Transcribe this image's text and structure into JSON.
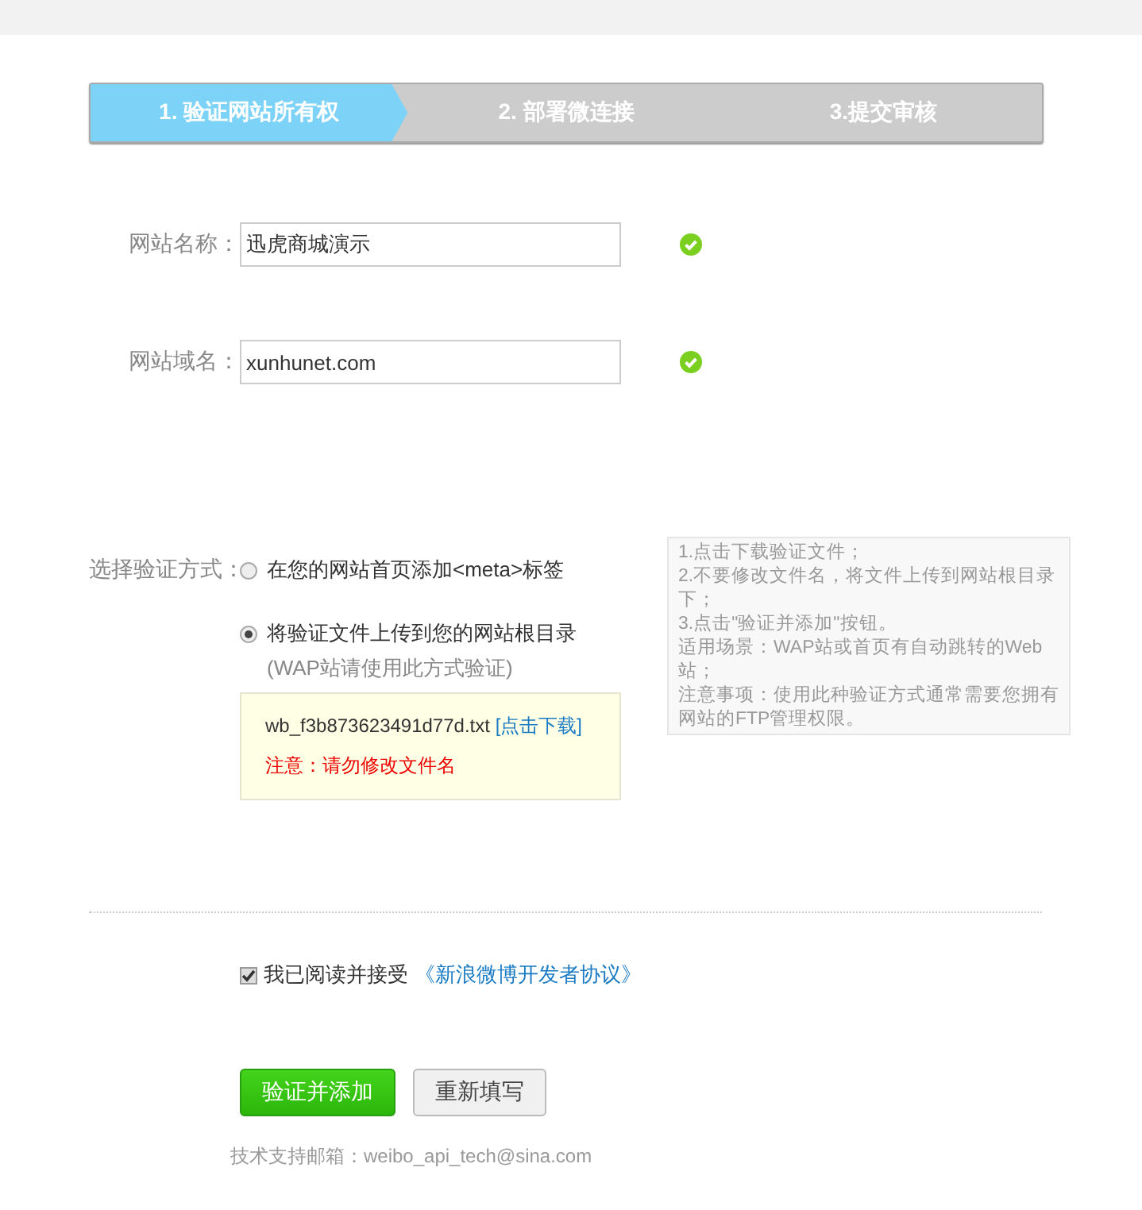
{
  "steps": [
    {
      "label": "1. 验证网站所有权",
      "selected": true
    },
    {
      "label": "2. 部署微连接",
      "selected": false
    },
    {
      "label": "3.提交审核",
      "selected": false
    }
  ],
  "fields": [
    {
      "label": "网站名称：",
      "value": "迅虎商城演示",
      "valid": true
    },
    {
      "label": "网站域名：",
      "value": "xunhunet.com",
      "valid": true
    }
  ],
  "verification": {
    "label": "选择验证方式：",
    "options": [
      {
        "label": "在您的网站首页添加<meta>标签",
        "selected": false
      },
      {
        "label": "将验证文件上传到您的网站根目录",
        "note": "(WAP站请使用此方式验证)",
        "selected": true
      }
    ],
    "file": {
      "name": "wb_f3b873623491d77d.txt",
      "link": "[点击下载]",
      "warning": "注意：请勿修改文件名"
    },
    "help": [
      "1.点击下载验证文件；",
      "2.不要修改文件名，将文件上传到网站根目录下；",
      "3.点击\"验证并添加\"按钮。",
      "适用场景：WAP站或首页有自动跳转的Web站；",
      "注意事项：使用此种验证方式通常需要您拥有网站的FTP管理权限。"
    ]
  },
  "agreement": {
    "text": "我已阅读并接受",
    "link": "《新浪微博开发者协议》",
    "checked": true
  },
  "buttons": [
    {
      "label": "验证并添加",
      "kind": "primary"
    },
    {
      "label": "重新填写",
      "kind": "secondary"
    }
  ],
  "footer": "技术支持邮箱：weibo_api_tech@sina.com"
}
